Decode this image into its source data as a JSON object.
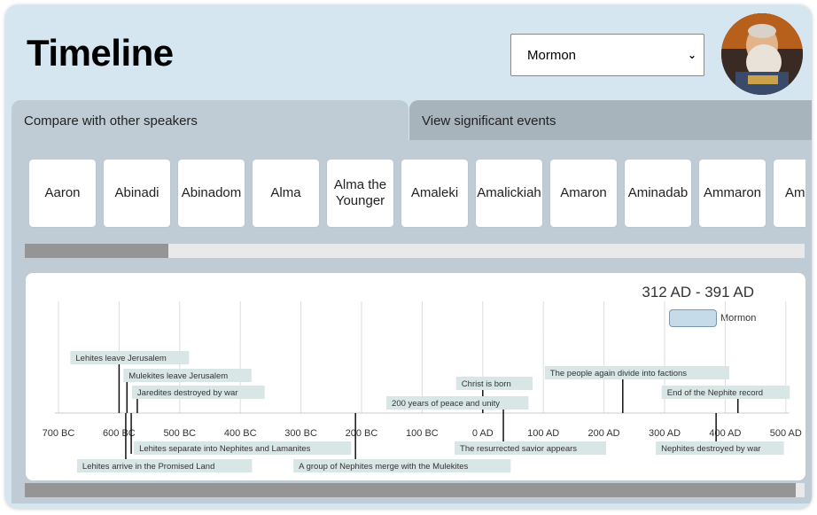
{
  "page_title": "Timeline",
  "speaker_select": {
    "value": "Mormon",
    "options_visible": [
      "Mormon"
    ]
  },
  "tabs": [
    {
      "label": "Compare with other speakers",
      "active": true
    },
    {
      "label": "View significant events",
      "active": false
    }
  ],
  "speakers": [
    "Aaron",
    "Abinadi",
    "Abinadom",
    "Alma",
    "Alma the Younger",
    "Amaleki",
    "Amalickiah",
    "Amaron",
    "Aminadab",
    "Ammaron",
    "Amr"
  ],
  "timeline": {
    "date_range": "312 AD - 391 AD",
    "legend": {
      "label": "Mormon",
      "color": "#c5dbea"
    },
    "axis_ticks": [
      "700 BC",
      "600 BC",
      "500 BC",
      "400 BC",
      "300 BC",
      "200 BC",
      "100 BC",
      "0 AD",
      "100 AD",
      "200 AD",
      "300 AD",
      "400 AD",
      "500 AD"
    ],
    "events": [
      {
        "label": "Lehites leave Jerusalem",
        "year": -600,
        "side": "above"
      },
      {
        "label": "Mulekites leave Jerusalem",
        "year": -587,
        "side": "above"
      },
      {
        "label": "Jaredites destroyed by war",
        "year": -570,
        "side": "above"
      },
      {
        "label": "Christ is born",
        "year": 0,
        "side": "above"
      },
      {
        "label": "The people again divide into factions",
        "year": 231,
        "side": "above"
      },
      {
        "label": "200 years of peace and unity",
        "year": 34,
        "side": "above"
      },
      {
        "label": "End of the Nephite record",
        "year": 421,
        "side": "above"
      },
      {
        "label": "Lehites separate into Nephites and Lamanites",
        "year": -580,
        "side": "below"
      },
      {
        "label": "Lehites arrive in the Promised Land",
        "year": -589,
        "side": "below"
      },
      {
        "label": "A group of Nephites merge with the Mulekites",
        "year": -210,
        "side": "below"
      },
      {
        "label": "The resurrected savior appears",
        "year": 34,
        "side": "below"
      },
      {
        "label": "Nephites destroyed by war",
        "year": 385,
        "side": "below"
      }
    ]
  },
  "colors": {
    "background": "#d6e6f1",
    "panel": "#bfccd5",
    "event_label_bg": "#d8e6e6",
    "scroll_thumb": "#959595"
  }
}
